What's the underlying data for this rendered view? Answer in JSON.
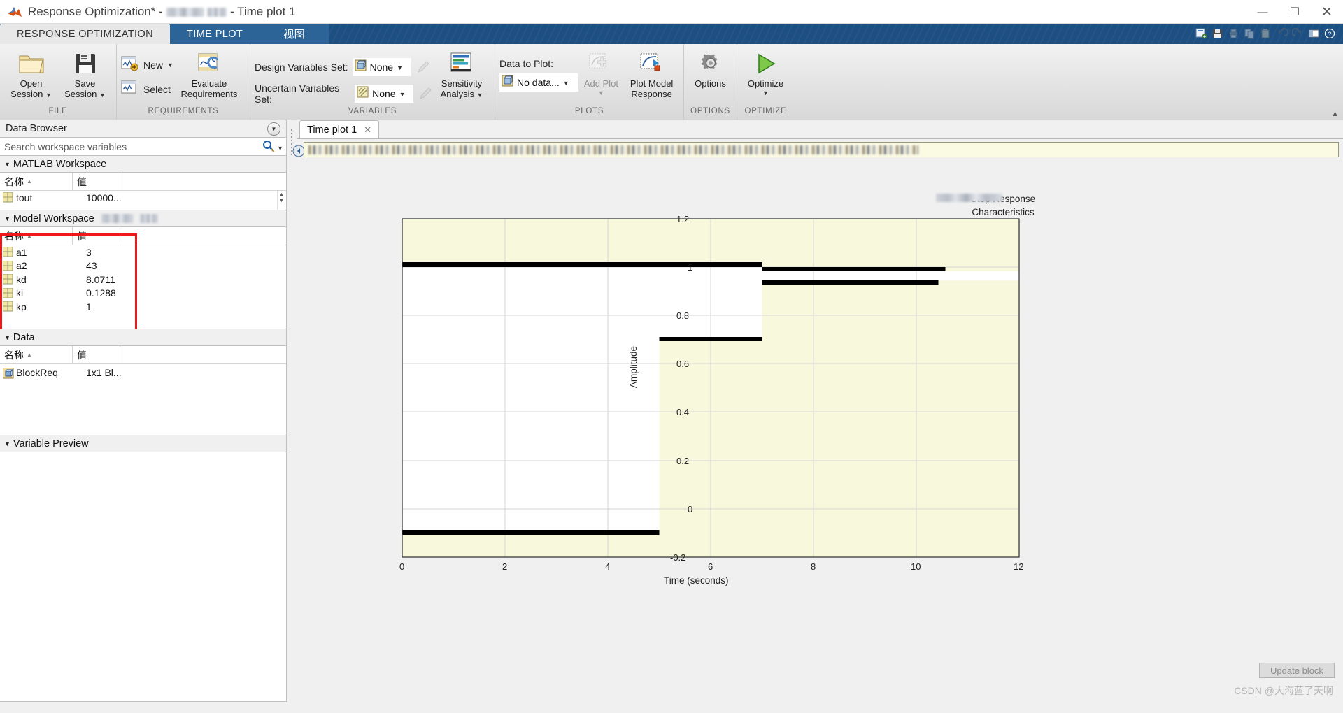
{
  "window": {
    "title_prefix": "Response Optimization*",
    "title_sep1": "-",
    "title_blurred": "",
    "title_sep2": "-",
    "title_suffix": "Time plot 1",
    "minimize": "—",
    "maximize": "❐",
    "close": "✕"
  },
  "ribbon_tabs": [
    {
      "label": "RESPONSE OPTIMIZATION",
      "active": true
    },
    {
      "label": "TIME PLOT",
      "active": false
    },
    {
      "label": "视图",
      "active": false
    }
  ],
  "quick_access": [
    "new-figure-icon",
    "save-icon",
    "print-icon",
    "copy-icon",
    "paste-icon",
    "undo-icon",
    "redo-icon",
    "layout-icon",
    "help-icon"
  ],
  "ribbon": {
    "groups": [
      {
        "name": "FILE",
        "label": "FILE",
        "buttons": [
          {
            "label": "Open\nSession",
            "label_l1": "Open",
            "label_l2": "Session",
            "icon": "open-folder-icon",
            "has_caret": true
          },
          {
            "label": "Save\nSession",
            "label_l1": "Save",
            "label_l2": "Session",
            "icon": "save-disk-icon",
            "has_caret": true
          }
        ]
      },
      {
        "name": "REQUIREMENTS",
        "label": "REQUIREMENTS",
        "small_buttons": [
          {
            "label": "New",
            "icon": "new-requirement-icon",
            "has_caret": true
          },
          {
            "label": "Select",
            "icon": "select-requirement-icon",
            "has_caret": false
          }
        ],
        "buttons": [
          {
            "label_l1": "Evaluate",
            "label_l2": "Requirements",
            "icon": "evaluate-requirements-icon",
            "has_caret": false
          }
        ]
      },
      {
        "name": "VARIABLES",
        "label": "VARIABLES",
        "fields": [
          {
            "label": "Design Variables Set:",
            "value": "None",
            "icon": "design-variables-icon"
          },
          {
            "label": "Uncertain Variables Set:",
            "value": "None",
            "icon": "uncertain-variables-icon"
          }
        ],
        "buttons": [
          {
            "label_l1": "Sensitivity",
            "label_l2": "Analysis",
            "icon": "sensitivity-analysis-icon",
            "has_caret": true
          }
        ]
      },
      {
        "name": "PLOTS",
        "label": "PLOTS",
        "data_to_plot_label": "Data to Plot:",
        "data_to_plot_value": "No data...",
        "buttons": [
          {
            "label_l1": "Add Plot",
            "label_l2": "",
            "icon": "add-plot-icon",
            "has_caret": true,
            "disabled": true
          },
          {
            "label_l1": "Plot Model",
            "label_l2": "Response",
            "icon": "plot-model-response-icon",
            "has_caret": false
          }
        ]
      },
      {
        "name": "OPTIONS",
        "label": "OPTIONS",
        "buttons": [
          {
            "label_l1": "Options",
            "label_l2": "",
            "icon": "gear-icon",
            "has_caret": false
          }
        ]
      },
      {
        "name": "OPTIMIZE",
        "label": "OPTIMIZE",
        "buttons": [
          {
            "label_l1": "Optimize",
            "label_l2": "",
            "icon": "play-triangle-icon",
            "has_caret": true
          }
        ]
      }
    ]
  },
  "browser": {
    "title": "Data Browser",
    "search_placeholder": "Search workspace variables",
    "columns": {
      "name": "名称",
      "value": "值"
    },
    "sections": [
      {
        "title": "MATLAB Workspace",
        "has_blur": false,
        "rows": [
          {
            "name": "tout",
            "value": "10000...",
            "icon": "matrix-icon"
          }
        ]
      },
      {
        "title": "Model Workspace",
        "has_blur": true,
        "highlighted": true,
        "rows": [
          {
            "name": "a1",
            "value": "3",
            "icon": "matrix-icon"
          },
          {
            "name": "a2",
            "value": "43",
            "icon": "matrix-icon"
          },
          {
            "name": "kd",
            "value": "8.0711",
            "icon": "matrix-icon"
          },
          {
            "name": "ki",
            "value": "0.1288",
            "icon": "matrix-icon"
          },
          {
            "name": "kp",
            "value": "1",
            "icon": "matrix-icon"
          }
        ]
      },
      {
        "title": "Data",
        "has_blur": false,
        "rows": [
          {
            "name": "BlockReq",
            "value": "1x1 Bl...",
            "icon": "block-icon"
          }
        ]
      },
      {
        "title": "Variable Preview",
        "has_blur": false,
        "rows": []
      }
    ]
  },
  "plot_pane": {
    "tab_label": "Time plot 1",
    "tab_close": "✕",
    "update_block_label": "Update block",
    "watermark": "CSDN @大海蓝了天啊"
  },
  "chart_data": {
    "type": "area",
    "title": "Step Response\nCharacteristics",
    "title_line1": "Step Response",
    "title_line2": "Characteristics",
    "xlabel": "Time (seconds)",
    "ylabel": "Amplitude",
    "xlim": [
      0,
      12
    ],
    "ylim": [
      -0.2,
      1.2
    ],
    "xticks": [
      0,
      2,
      4,
      6,
      8,
      10,
      12
    ],
    "xticklabels": [
      "0",
      "2",
      "4",
      "6",
      "8",
      "10",
      "12"
    ],
    "yticks": [
      -0.2,
      0,
      0.2,
      0.4,
      0.6,
      0.8,
      1.0,
      1.2
    ],
    "yticklabels": [
      "-0.2",
      "0",
      "0.2",
      "0.4",
      "0.6",
      "0.8",
      "1",
      "1.2"
    ],
    "grid": true,
    "background_color": "#f8f8dc",
    "feasible_color": "#ffffff",
    "constraint_color": "#000000",
    "constraint_segments": [
      {
        "name": "overshoot-upper-bound",
        "x0": 0.0,
        "x1": 7.0,
        "y": 1.1,
        "thickness": 0.022
      },
      {
        "name": "settling-upper-bound",
        "x0": 7.0,
        "x1": 11.0,
        "y": 1.02,
        "thickness": 0.016
      },
      {
        "name": "settling-lower-bound",
        "x0": 7.0,
        "x1": 10.6,
        "y": 0.985,
        "thickness": 0.016
      },
      {
        "name": "rise-time-lower-bound",
        "x0": 5.0,
        "x1": 7.0,
        "y": 0.8,
        "thickness": 0.016
      },
      {
        "name": "initial-lower-bound",
        "x0": 0.0,
        "x1": 5.0,
        "y": 0.0,
        "thickness": 0.016
      }
    ],
    "feasible_regions": [
      {
        "name": "left-white-region",
        "x0": 0.0,
        "x1": 5.0,
        "y0": 0.0,
        "y1": 1.1
      },
      {
        "name": "rise-white-region",
        "x0": 5.0,
        "x1": 7.0,
        "y0": 0.8,
        "y1": 1.1
      },
      {
        "name": "settle-white-region",
        "x0": 7.0,
        "x1": 12.0,
        "y0": 0.985,
        "y1": 1.02
      }
    ]
  }
}
